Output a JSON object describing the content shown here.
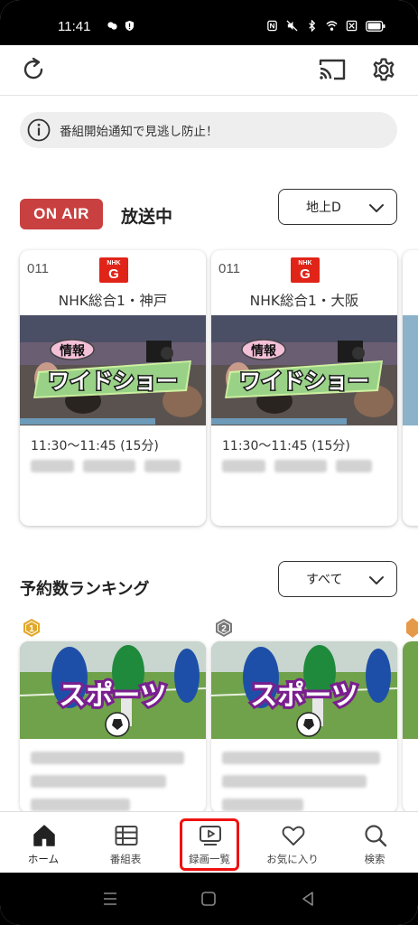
{
  "status_bar": {
    "time": "11:41"
  },
  "notice": {
    "text": "番組開始通知で見逃し防止！"
  },
  "on_air": {
    "badge": "ON AIR",
    "title": "放送中",
    "filter_value": "地上D"
  },
  "channels": [
    {
      "number": "011",
      "logo_top": "NHK",
      "logo_letter": "G",
      "name": "NHK総合1・神戸",
      "thumb_tag": "情報",
      "thumb_title": "ワイドショー",
      "time": "11:30〜11:45 (15分)",
      "progress": 0.73
    },
    {
      "number": "011",
      "logo_top": "NHK",
      "logo_letter": "G",
      "name": "NHK総合1・大阪",
      "thumb_tag": "情報",
      "thumb_title": "ワイドショー",
      "time": "11:30〜11:45 (15分)",
      "progress": 0.73
    }
  ],
  "ranking": {
    "title": "予約数ランキング",
    "filter_value": "すべて",
    "items": [
      {
        "rank": "1",
        "thumb_title": "スポーツ",
        "badge_color": "#e2a92c"
      },
      {
        "rank": "2",
        "thumb_title": "スポーツ",
        "badge_color": "#7a7a7a"
      }
    ]
  },
  "bottom_nav": {
    "items": [
      {
        "label": "ホーム",
        "icon": "home-icon"
      },
      {
        "label": "番組表",
        "icon": "program-guide-icon"
      },
      {
        "label": "録画一覧",
        "icon": "recording-list-icon"
      },
      {
        "label": "お気に入り",
        "icon": "heart-icon"
      },
      {
        "label": "検索",
        "icon": "search-icon"
      }
    ]
  },
  "colors": {
    "onair_red": "#c94040",
    "progress_blue": "#6d9ab8",
    "nhk_red": "#e02418",
    "highlight_red": "#f01010"
  }
}
